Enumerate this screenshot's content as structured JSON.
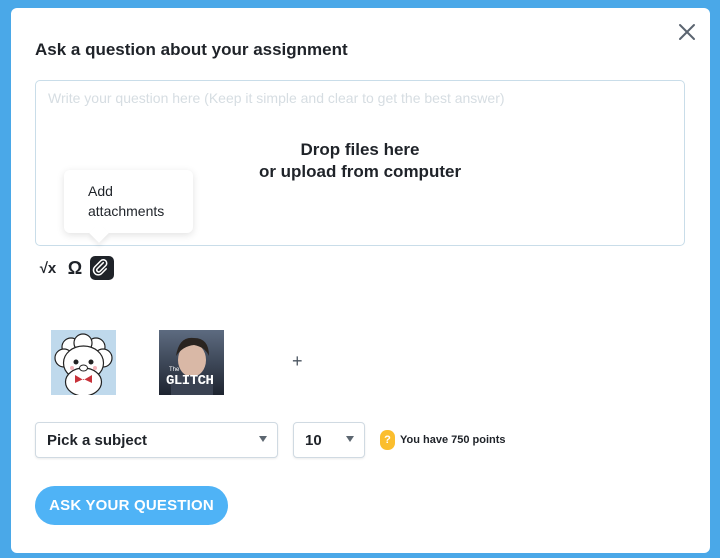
{
  "modal": {
    "title": "Ask a question about your assignment",
    "question_placeholder": "Write your question here (Keep it simple and clear to get the best answer)",
    "drop_zone": {
      "line1": "Drop files here",
      "line2": "or upload from computer"
    },
    "tooltip": {
      "line1": "Add",
      "line2": "attachments"
    },
    "toolbar": {
      "math_symbol": "√x",
      "symbol_symbol": "Ω",
      "attachment_icon": "paperclip-icon"
    },
    "attachments": {
      "add_more_label": "+",
      "items": [
        {
          "icon": "bt21-rj-image",
          "caption": ""
        },
        {
          "icon": "glitch-photo-image",
          "caption": "GLITCH",
          "small_caption": "The"
        }
      ]
    },
    "subject_select": {
      "value": "Pick a subject"
    },
    "points_select": {
      "value": "10"
    },
    "points_info": {
      "badge": "?",
      "text": "You have 750 points"
    },
    "submit_label": "ASK YOUR QUESTION",
    "close_icon": "close-icon"
  },
  "colors": {
    "backdrop": "#4aa8e8",
    "accent": "#4fb3f6",
    "points_badge": "#fbbe2e",
    "text": "#1f2329"
  }
}
